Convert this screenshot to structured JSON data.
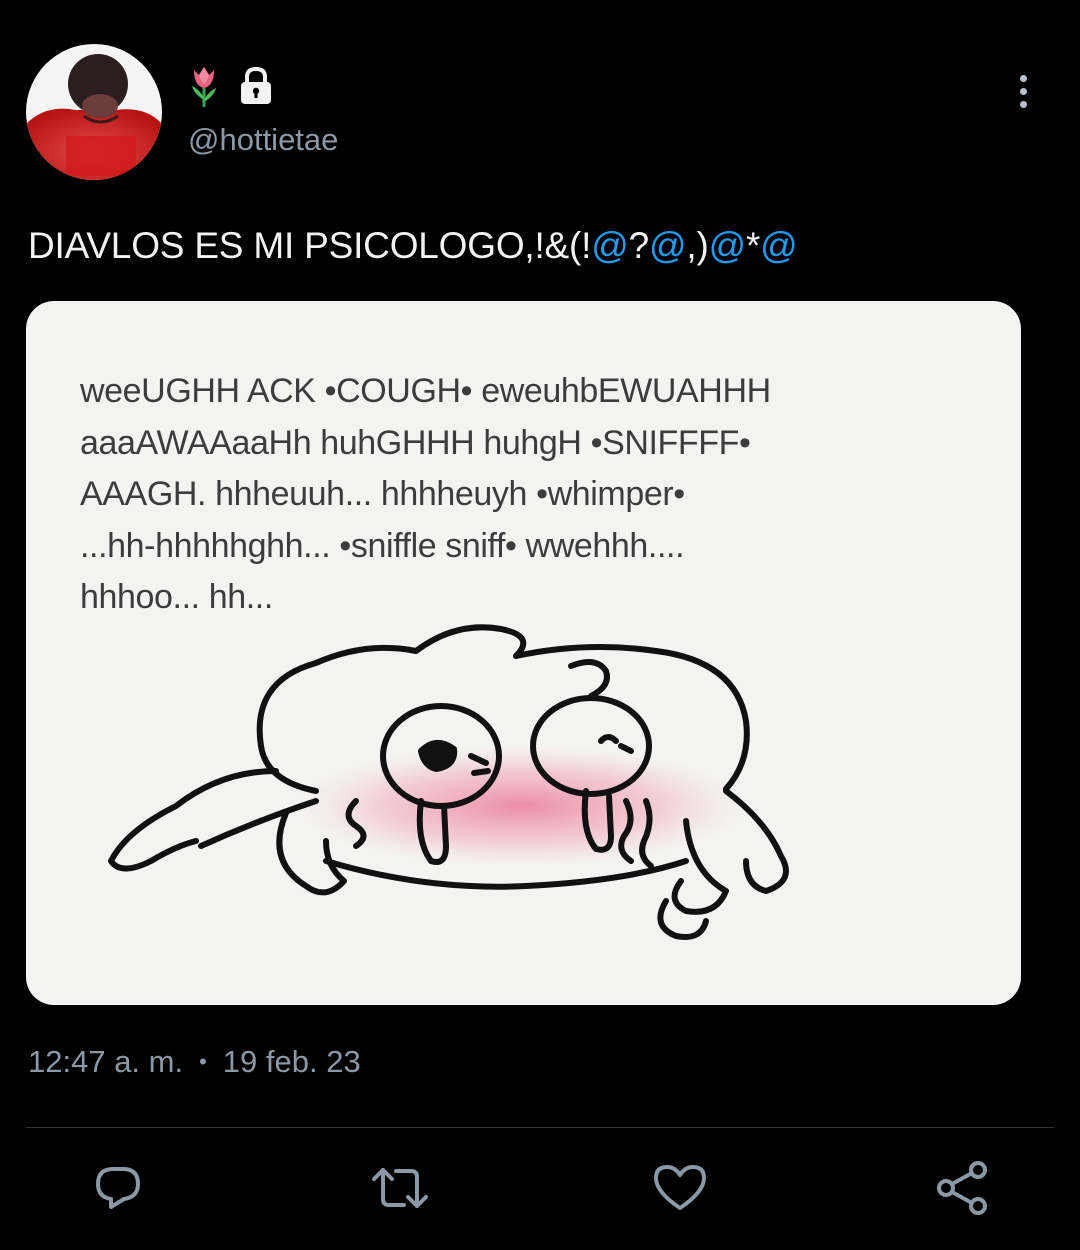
{
  "user": {
    "handle": "@hottietae",
    "name_icons": [
      "tulip-icon",
      "lock-icon"
    ]
  },
  "tweet": {
    "text_plain": "DIAVLOS ES MI PSICOLOGO,!&(!",
    "text_link1": "@",
    "text_mid1": "?",
    "text_link2": "@",
    "text_mid2": ",)",
    "text_link3": "@",
    "text_mid3": "*",
    "text_link4": "@"
  },
  "media": {
    "meme_text": "weeUGHH ACK •COUGH• eweuhbEWUAHHH\naaaAWAAaaHh huhGHHH huhgH •SNIFFFF•\nAAAGH. hhheuuh... hhhheuyh •whimper•\n...hh-hhhhhghh... •sniffle sniff• wwehhh....\nhhhoo... hh..."
  },
  "meta": {
    "time": "12:47 a. m.",
    "separator": "•",
    "date": "19 feb. 23"
  },
  "actions": [
    "reply-icon",
    "retweet-icon",
    "like-icon",
    "share-icon"
  ],
  "colors": {
    "background": "#000000",
    "link": "#1d9bf0",
    "muted": "#8b98a5",
    "icon": "#8b98a5"
  }
}
